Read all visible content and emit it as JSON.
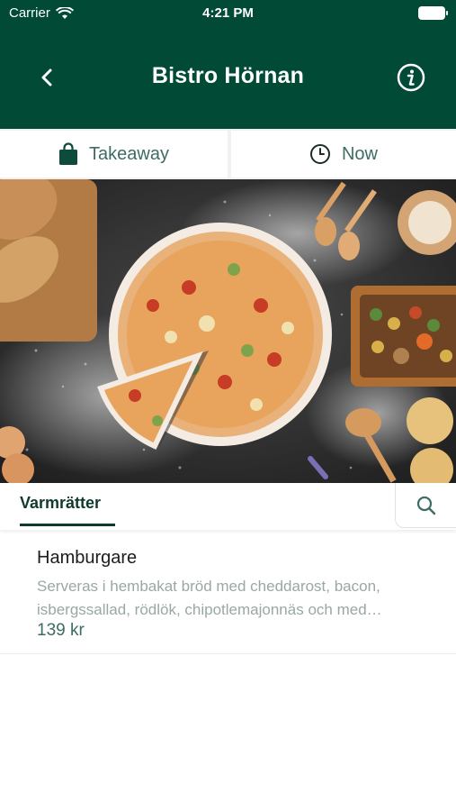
{
  "status_bar": {
    "carrier": "Carrier",
    "time": "4:21 PM"
  },
  "header": {
    "title": "Bistro Hörnan",
    "back_icon": "chevron-left-icon",
    "info_icon": "info-icon"
  },
  "order_options": {
    "takeaway_label": "Takeaway",
    "takeaway_icon": "shopping-bag-icon",
    "time_label": "Now",
    "time_icon": "clock-icon"
  },
  "hero": {
    "subject": "pizza-photo"
  },
  "categories": {
    "active_label": "Varmrätter",
    "search_icon": "search-icon"
  },
  "menu_items": [
    {
      "name": "Hamburgare",
      "description": "Serveras i hembakat bröd med cheddarost, bacon, isbergssallad, rödlök, chipotlemajonnäs och med…",
      "price": "139 kr"
    }
  ],
  "colors": {
    "brand_green": "#004a36",
    "accent_text": "#3e6b64",
    "muted_text": "#9aa8a5"
  }
}
